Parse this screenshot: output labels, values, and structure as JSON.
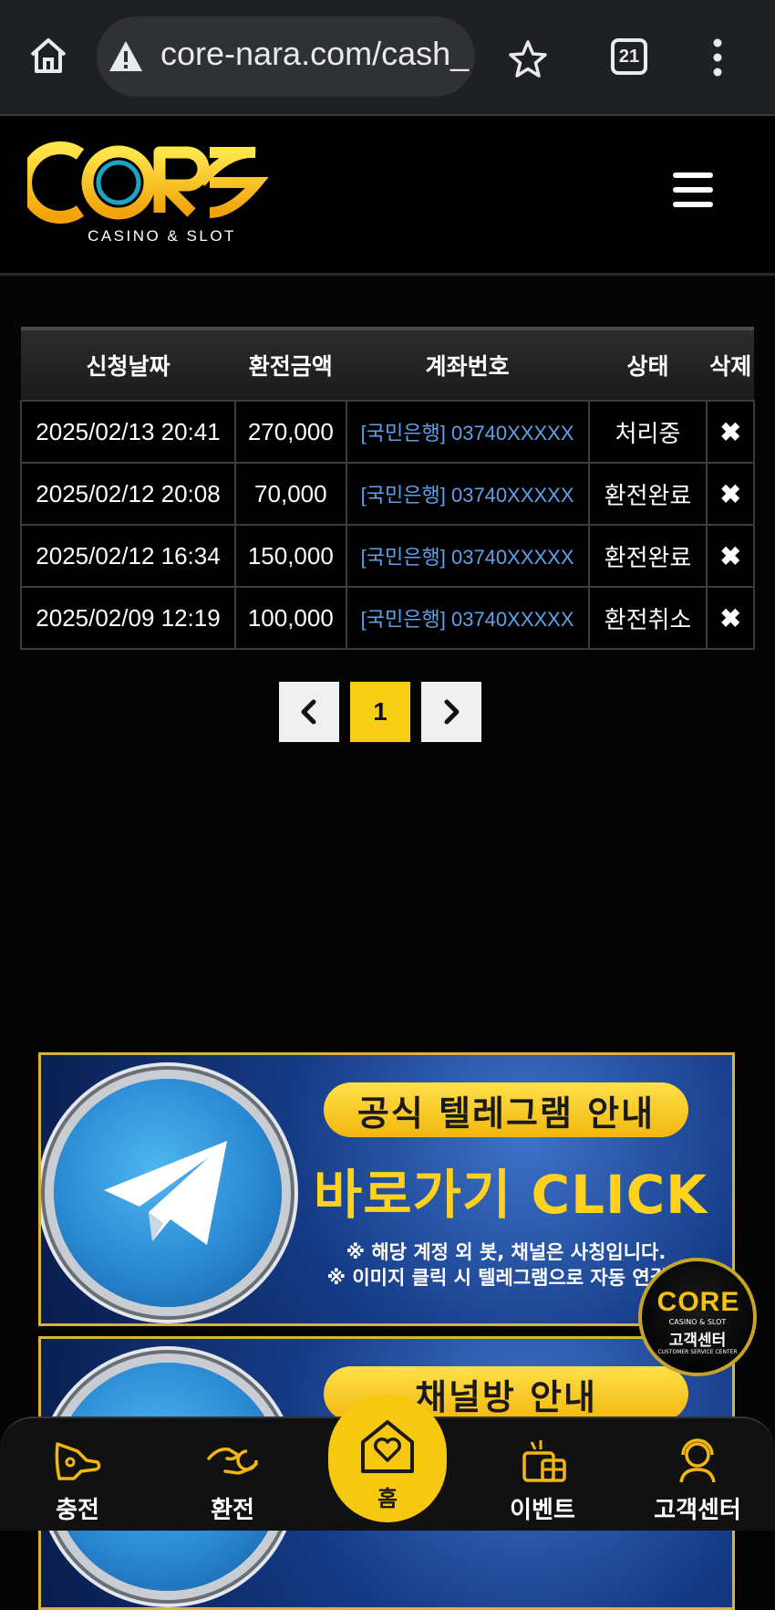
{
  "browser": {
    "url": "core-nara.com/cash_",
    "tab_count": "21"
  },
  "site": {
    "logo_text": "CORE",
    "logo_sub": "CASINO & SLOT"
  },
  "table": {
    "headers": [
      "신청날짜",
      "환전금액",
      "계좌번호",
      "상태",
      "삭제"
    ],
    "rows": [
      {
        "date": "2025/02/13 20:41",
        "amount": "270,000",
        "account": "[국민은행] 03740XXXXX",
        "status": "처리중"
      },
      {
        "date": "2025/02/12 20:08",
        "amount": "70,000",
        "account": "[국민은행] 03740XXXXX",
        "status": "환전완료"
      },
      {
        "date": "2025/02/12 16:34",
        "amount": "150,000",
        "account": "[국민은행] 03740XXXXX",
        "status": "환전완료"
      },
      {
        "date": "2025/02/09 12:19",
        "amount": "100,000",
        "account": "[국민은행] 03740XXXXX",
        "status": "환전취소"
      }
    ],
    "delete_glyph": "✖"
  },
  "pagination": {
    "prev": "‹",
    "current": "1",
    "next": "›"
  },
  "banners": {
    "telegram": {
      "title": "공식 텔레그램 안내",
      "cta": "바로가기 CLICK",
      "note1": "※ 해당 계정 외 봇, 채널은 사칭입니다.",
      "note2": "※ 이미지 클릭 시 텔레그램으로 자동 연결됩"
    },
    "second_partial_title": "채널방 안내"
  },
  "cs_float": {
    "logo": "CORE",
    "sub": "CASINO & SLOT",
    "label": "고객센터",
    "en": "CUSTOMER SERVICE CENTER"
  },
  "bottom_nav": {
    "charge": "충전",
    "exchange": "환전",
    "home": "홈",
    "event": "이벤트",
    "support": "고객센터"
  },
  "colors": {
    "accent_yellow": "#f6c80f",
    "link_blue": "#5ea1e8",
    "background": "#050505"
  }
}
